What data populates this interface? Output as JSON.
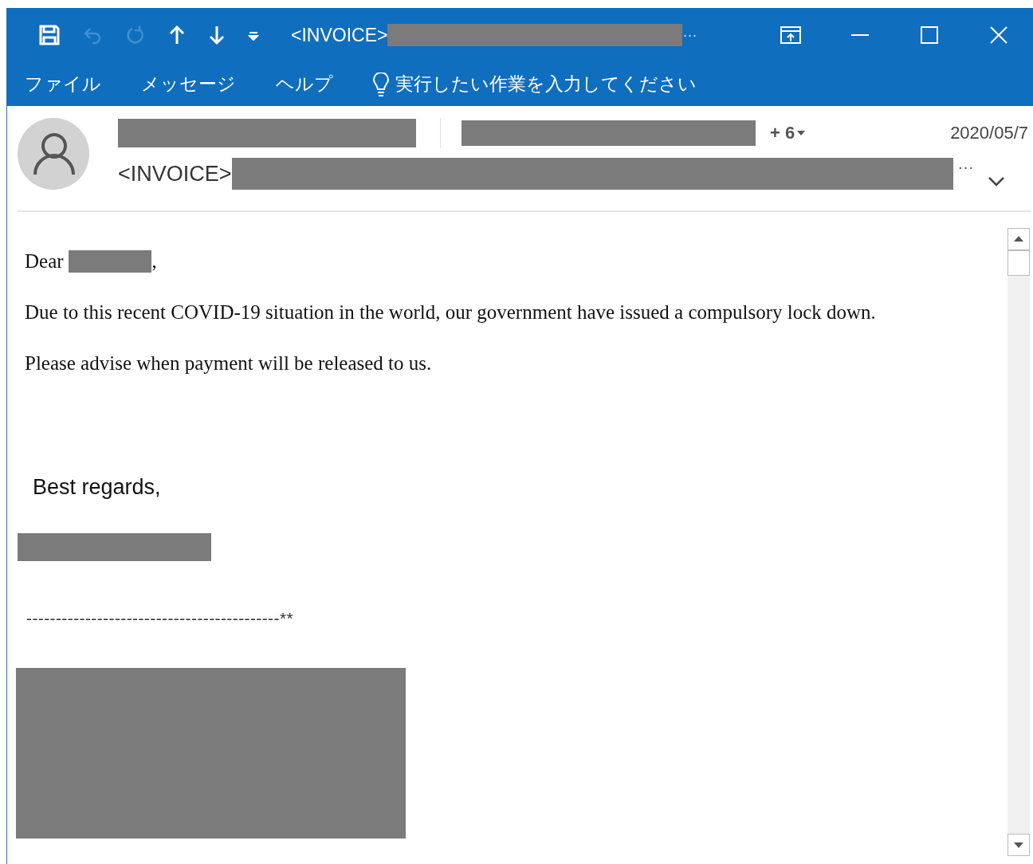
{
  "title_bar": {
    "quick_access": [
      {
        "kind": "save",
        "disabled": false
      },
      {
        "kind": "undo",
        "disabled": true
      },
      {
        "kind": "redo",
        "disabled": true
      },
      {
        "kind": "up",
        "disabled": false
      },
      {
        "kind": "down",
        "disabled": false
      },
      {
        "kind": "customize",
        "disabled": false
      }
    ],
    "title": "<INVOICE>",
    "title_overflow": "···"
  },
  "menu": {
    "items": [
      "ファイル",
      "メッセージ",
      "ヘルプ"
    ],
    "tell_me": "実行したい作業を入力してください"
  },
  "header": {
    "more_recipients": "+ 6",
    "date": "2020/05/7",
    "subject": "<INVOICE>",
    "subject_overflow": "···"
  },
  "body": {
    "greeting": "Dear",
    "greeting_end": ",",
    "paragraphs": [
      "Due to this recent COVID-19 situation in the world, our government have issued a compulsory lock down.",
      "Please advise when payment will be released to us."
    ],
    "closing": "Best regards,",
    "separator": "-------------------------------------------**"
  }
}
